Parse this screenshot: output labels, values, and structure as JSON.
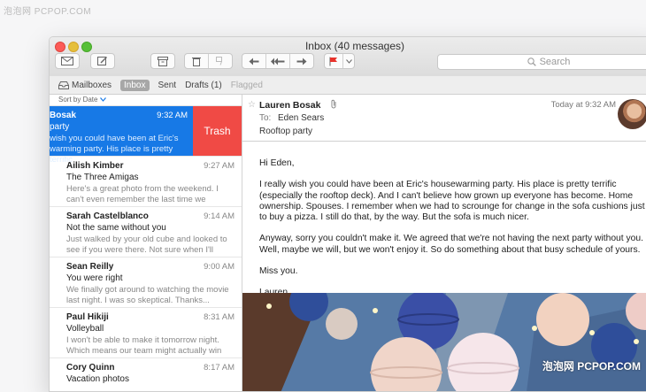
{
  "watermark_top": "泡泡网 PCPOP.COM",
  "watermark_bottom": "泡泡网 PCPOP.COM",
  "window": {
    "title": "Inbox (40 messages)"
  },
  "search": {
    "placeholder": "Search"
  },
  "favorites": [
    {
      "label": "Mailboxes",
      "icon": "tray-icon"
    },
    {
      "label": "Inbox"
    },
    {
      "label": "Sent"
    },
    {
      "label": "Drafts (1)"
    },
    {
      "label": "Flagged"
    }
  ],
  "sort": {
    "label": "Sort by Date",
    "chevron": "chevron-down-icon"
  },
  "messages": [
    {
      "from": "Bosak",
      "time": "9:32 AM",
      "subject": "party",
      "preview": "wish you could have been at Eric's warming party. His place is pretty terrific",
      "swipe_action": "Trash"
    },
    {
      "from": "Ailish Kimber",
      "time": "9:27 AM",
      "subject": "The Three Amigas",
      "preview": "Here's a great photo from the weekend. I can't even remember the last time we"
    },
    {
      "from": "Sarah Castelblanco",
      "time": "9:14 AM",
      "subject": "Not the same without you",
      "preview": "Just walked by your old cube and looked to see if you were there. Not sure when I'll"
    },
    {
      "from": "Sean Reilly",
      "time": "9:00 AM",
      "subject": "You were right",
      "preview": "We finally got around to watching the movie last night. I was so skeptical. Thanks..."
    },
    {
      "from": "Paul Hikiji",
      "time": "8:31 AM",
      "subject": "Volleyball",
      "preview": "I won't be able to make it tomorrow night. Which means our team might actually win"
    },
    {
      "from": "Cory Quinn",
      "time": "8:17 AM",
      "subject": "Vacation photos",
      "preview": ""
    }
  ],
  "viewer": {
    "from": "Lauren Bosak",
    "date": "Today at 9:32 AM",
    "to_label": "To:",
    "to": "Eden Sears",
    "subject": "Rooftop party",
    "body": [
      "Hi Eden,",
      "I really wish you could have been at Eric's housewarming party. His place is pretty terrific (especially the rooftop deck). And I can't believe how grown up everyone has become. Home ownership. Spouses. I remember when we had to scrounge for change in the sofa cushions just to buy a pizza. I still do that, by the way. But the sofa is much nicer.",
      "Anyway, sorry you couldn't make it. We agreed that we're not having the next party without you. Well, maybe we will, but we won't enjoy it. So do something about that busy schedule of yours.",
      "Miss you.",
      "Lauren"
    ]
  },
  "colors": {
    "selection": "#1779e6",
    "trash": "#f04a45",
    "flag": "#e8322b"
  }
}
